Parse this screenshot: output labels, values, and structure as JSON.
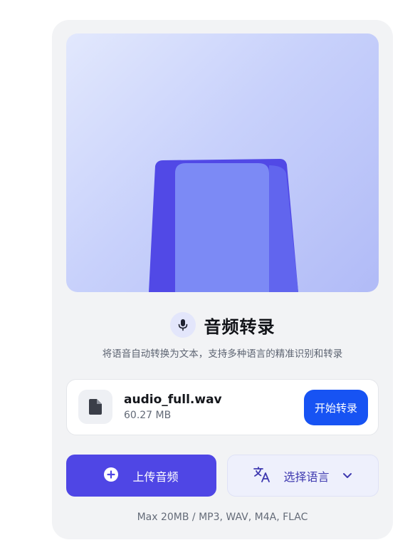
{
  "header": {
    "title": "音频转录",
    "subtitle": "将语音自动转换为文本，支持多种语言的精准识别和转录"
  },
  "file": {
    "name": "audio_full.wav",
    "size": "60.27 MB",
    "icon": "file-icon"
  },
  "actions": {
    "start_label": "开始转录",
    "upload_label": "上传音频",
    "language_label": "选择语言"
  },
  "footer": {
    "hint": "Max 20MB / MP3, WAV, M4A, FLAC"
  },
  "colors": {
    "primary": "#4f46e5",
    "start_button": "#1753f3",
    "card_bg": "#f2f3f5",
    "hero_gradient_start": "#e2e8fd",
    "hero_gradient_end": "#b1bbf7"
  }
}
